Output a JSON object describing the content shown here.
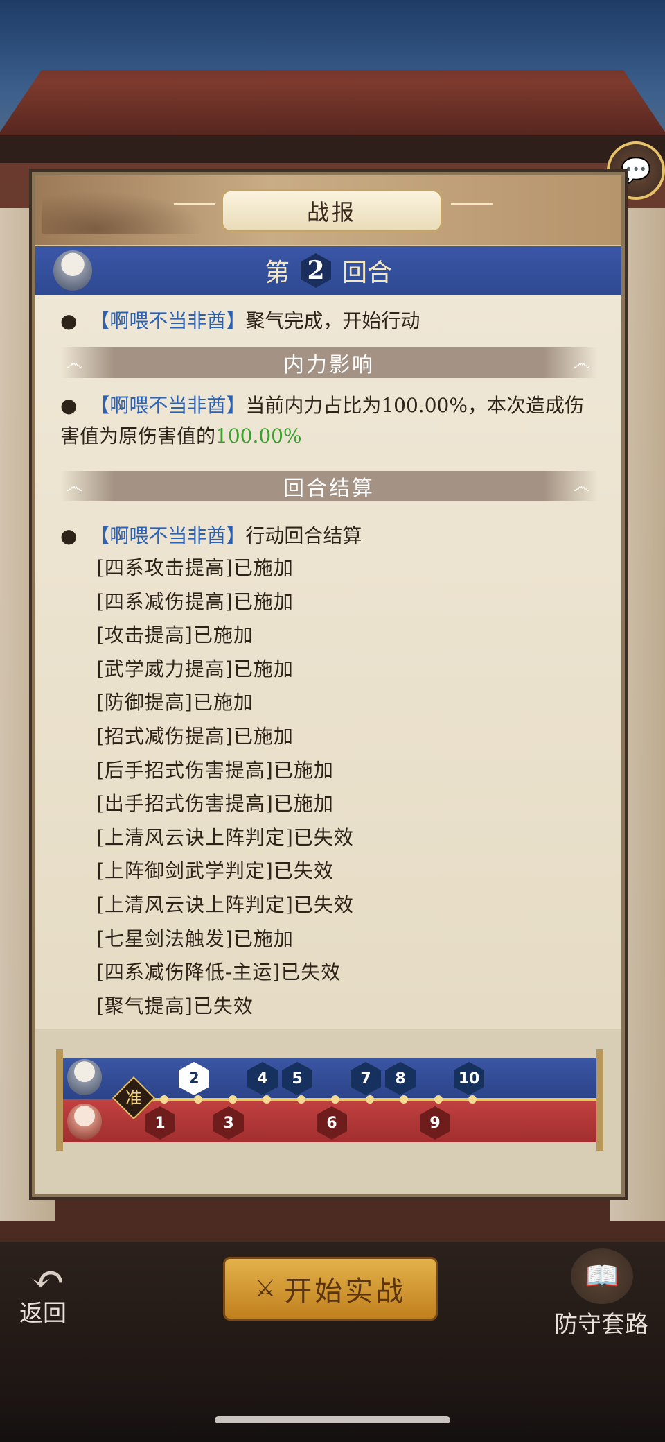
{
  "report": {
    "title": "战报",
    "round_prefix": "第",
    "round_number": "2",
    "round_suffix": "回合"
  },
  "log": {
    "line1": {
      "name": "【啊喂不当非酋】",
      "text": "聚气完成，开始行动"
    },
    "section1": "内力影响",
    "line2": {
      "name": "【啊喂不当非酋】",
      "text": "当前内力占比为100.00%，本次造成伤害值为原伤害值的",
      "value": "100.00%"
    },
    "section2": "回合结算",
    "line3": {
      "name": "【啊喂不当非酋】",
      "text": "行动回合结算"
    },
    "effects": [
      "[四系攻击提高]已施加",
      "[四系减伤提高]已施加",
      "[攻击提高]已施加",
      "[武学威力提高]已施加",
      "[防御提高]已施加",
      "[招式减伤提高]已施加",
      "[后手招式伤害提高]已施加",
      "[出手招式伤害提高]已施加",
      "[上清风云诀上阵判定]已失效",
      "[上阵御剑武学判定]已失效",
      "[上清风云诀上阵判定]已失效",
      "[七星剑法触发]已施加",
      "[四系减伤降低-主运]已失效",
      "[聚气提高]已失效"
    ]
  },
  "timeline": {
    "ready_label": "准",
    "blue_turns": [
      "2",
      "4",
      "5",
      "7",
      "8",
      "10"
    ],
    "red_turns": [
      "1",
      "3",
      "6",
      "9"
    ],
    "current_turn": "2"
  },
  "controls": {
    "back_label": "返回",
    "start_label": "开始实战",
    "defense_label": "防守套路"
  },
  "icons": {
    "chat": "chat-bubble-icon",
    "back": "return-arrow-icon",
    "start": "crossed-swords-icon",
    "defense": "book-icon"
  },
  "colors": {
    "name_blue": "#2a62b8",
    "value_green": "#39a02c",
    "round_bar": "#2f4a92",
    "enemy_bar": "#a12f2f"
  }
}
